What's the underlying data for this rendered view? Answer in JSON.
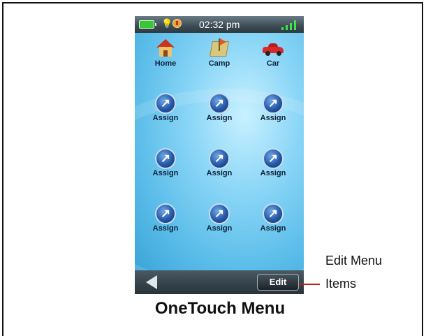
{
  "status_bar": {
    "time": "02:32 pm",
    "icons": [
      "battery-icon",
      "bulb-icon",
      "compass-icon",
      "signal-icon"
    ]
  },
  "menu": {
    "items": [
      {
        "label": "Home",
        "icon": "house-icon"
      },
      {
        "label": "Camp",
        "icon": "camp-map-icon"
      },
      {
        "label": "Car",
        "icon": "car-icon"
      },
      {
        "label": "Assign",
        "icon": "assign-icon"
      },
      {
        "label": "Assign",
        "icon": "assign-icon"
      },
      {
        "label": "Assign",
        "icon": "assign-icon"
      },
      {
        "label": "Assign",
        "icon": "assign-icon"
      },
      {
        "label": "Assign",
        "icon": "assign-icon"
      },
      {
        "label": "Assign",
        "icon": "assign-icon"
      },
      {
        "label": "Assign",
        "icon": "assign-icon"
      },
      {
        "label": "Assign",
        "icon": "assign-icon"
      },
      {
        "label": "Assign",
        "icon": "assign-icon"
      }
    ]
  },
  "bottom_bar": {
    "back_icon": "back-arrow-icon",
    "edit_label": "Edit"
  },
  "callout": {
    "line1": "Edit Menu",
    "line2": "Items"
  },
  "caption": "OneTouch Menu"
}
